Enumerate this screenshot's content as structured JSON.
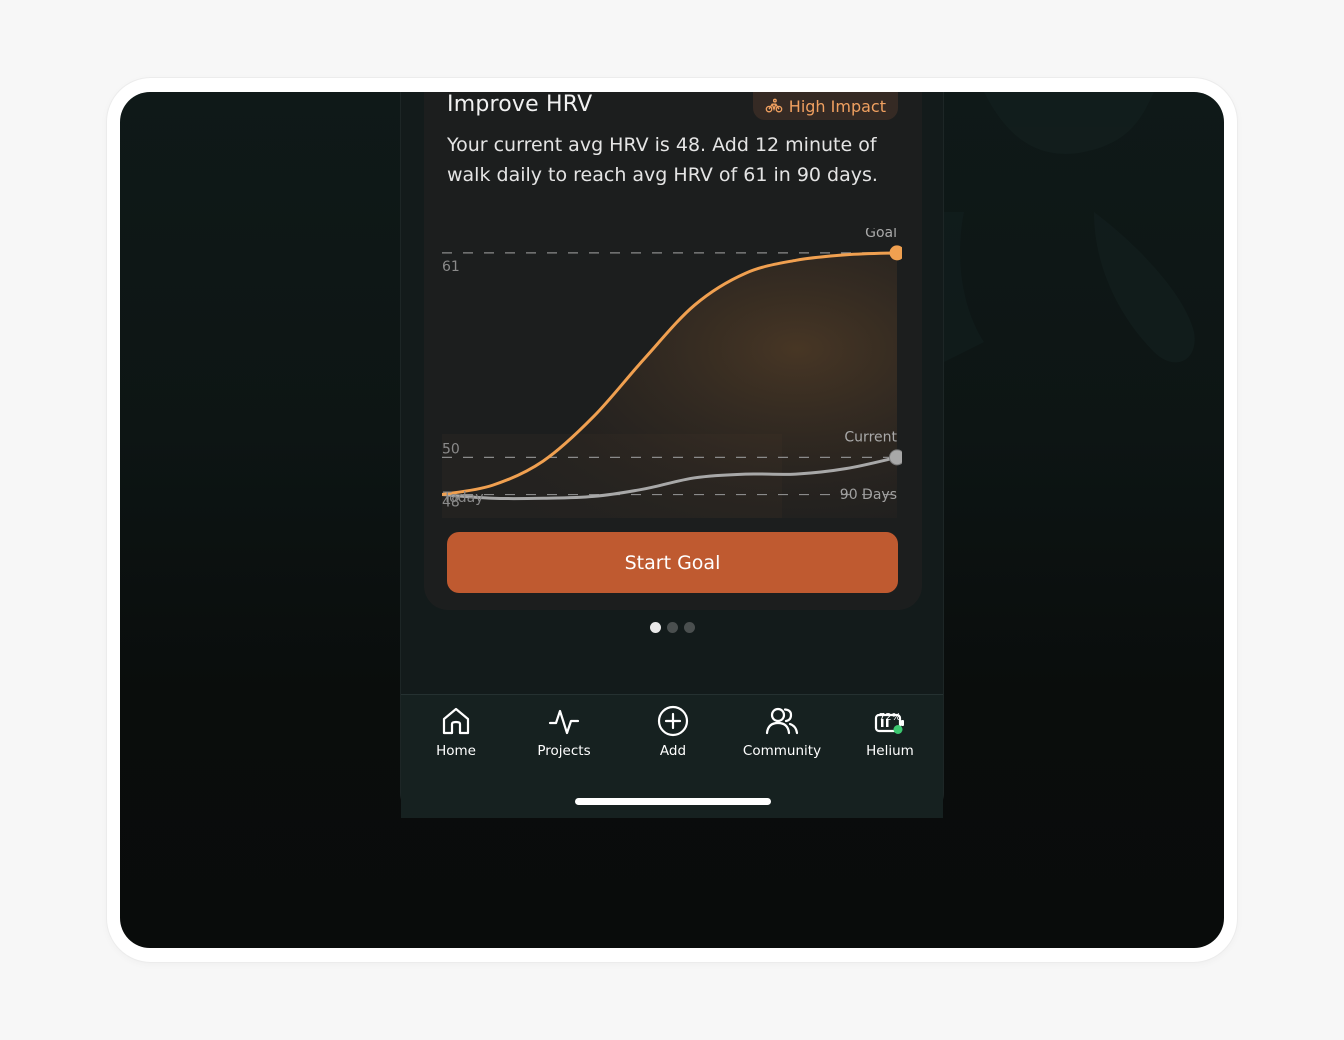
{
  "card": {
    "title": "Improve HRV",
    "badge_icon": "bicycle-icon",
    "badge_label": "High Impact",
    "description": "Your current avg HRV is 48. Add 12 minute of walk daily to reach avg HRV of 61 in 90 days.",
    "cta_label": "Start Goal"
  },
  "chart_data": {
    "type": "line",
    "x_labels": [
      "Today",
      "90 Days"
    ],
    "y_ticks": [
      "61",
      "50",
      "48"
    ],
    "series": [
      {
        "name": "Goal",
        "color": "#f0a050",
        "x": [
          0,
          10,
          20,
          30,
          40,
          50,
          60,
          70,
          80,
          90
        ],
        "values": [
          48,
          48.5,
          49.8,
          52.2,
          55.3,
          58.2,
          59.9,
          60.6,
          60.9,
          61
        ]
      },
      {
        "name": "Current",
        "color": "#a8a8a8",
        "x": [
          0,
          10,
          20,
          30,
          40,
          50,
          60,
          70,
          80,
          90
        ],
        "values": [
          48,
          47.8,
          47.8,
          47.9,
          48.3,
          48.9,
          49.1,
          49.1,
          49.4,
          50
        ]
      }
    ],
    "ylim": [
      46.2,
      61.8
    ],
    "grid": "dashed reference lines at 61, 50, 48"
  },
  "pager": {
    "count": 3,
    "active": 0
  },
  "tabbar": {
    "items": [
      {
        "label": "Home",
        "icon": "home-icon"
      },
      {
        "label": "Projects",
        "icon": "activity-icon"
      },
      {
        "label": "Add",
        "icon": "plus-circle-icon"
      },
      {
        "label": "Community",
        "icon": "users-icon"
      },
      {
        "label": "Helium",
        "icon": "battery-icon",
        "battery": "72%"
      }
    ]
  },
  "colors": {
    "accent": "#bf5a30",
    "goal_line": "#f0a050",
    "current_line": "#a8a8a8",
    "status_dot": "#3cc870"
  }
}
